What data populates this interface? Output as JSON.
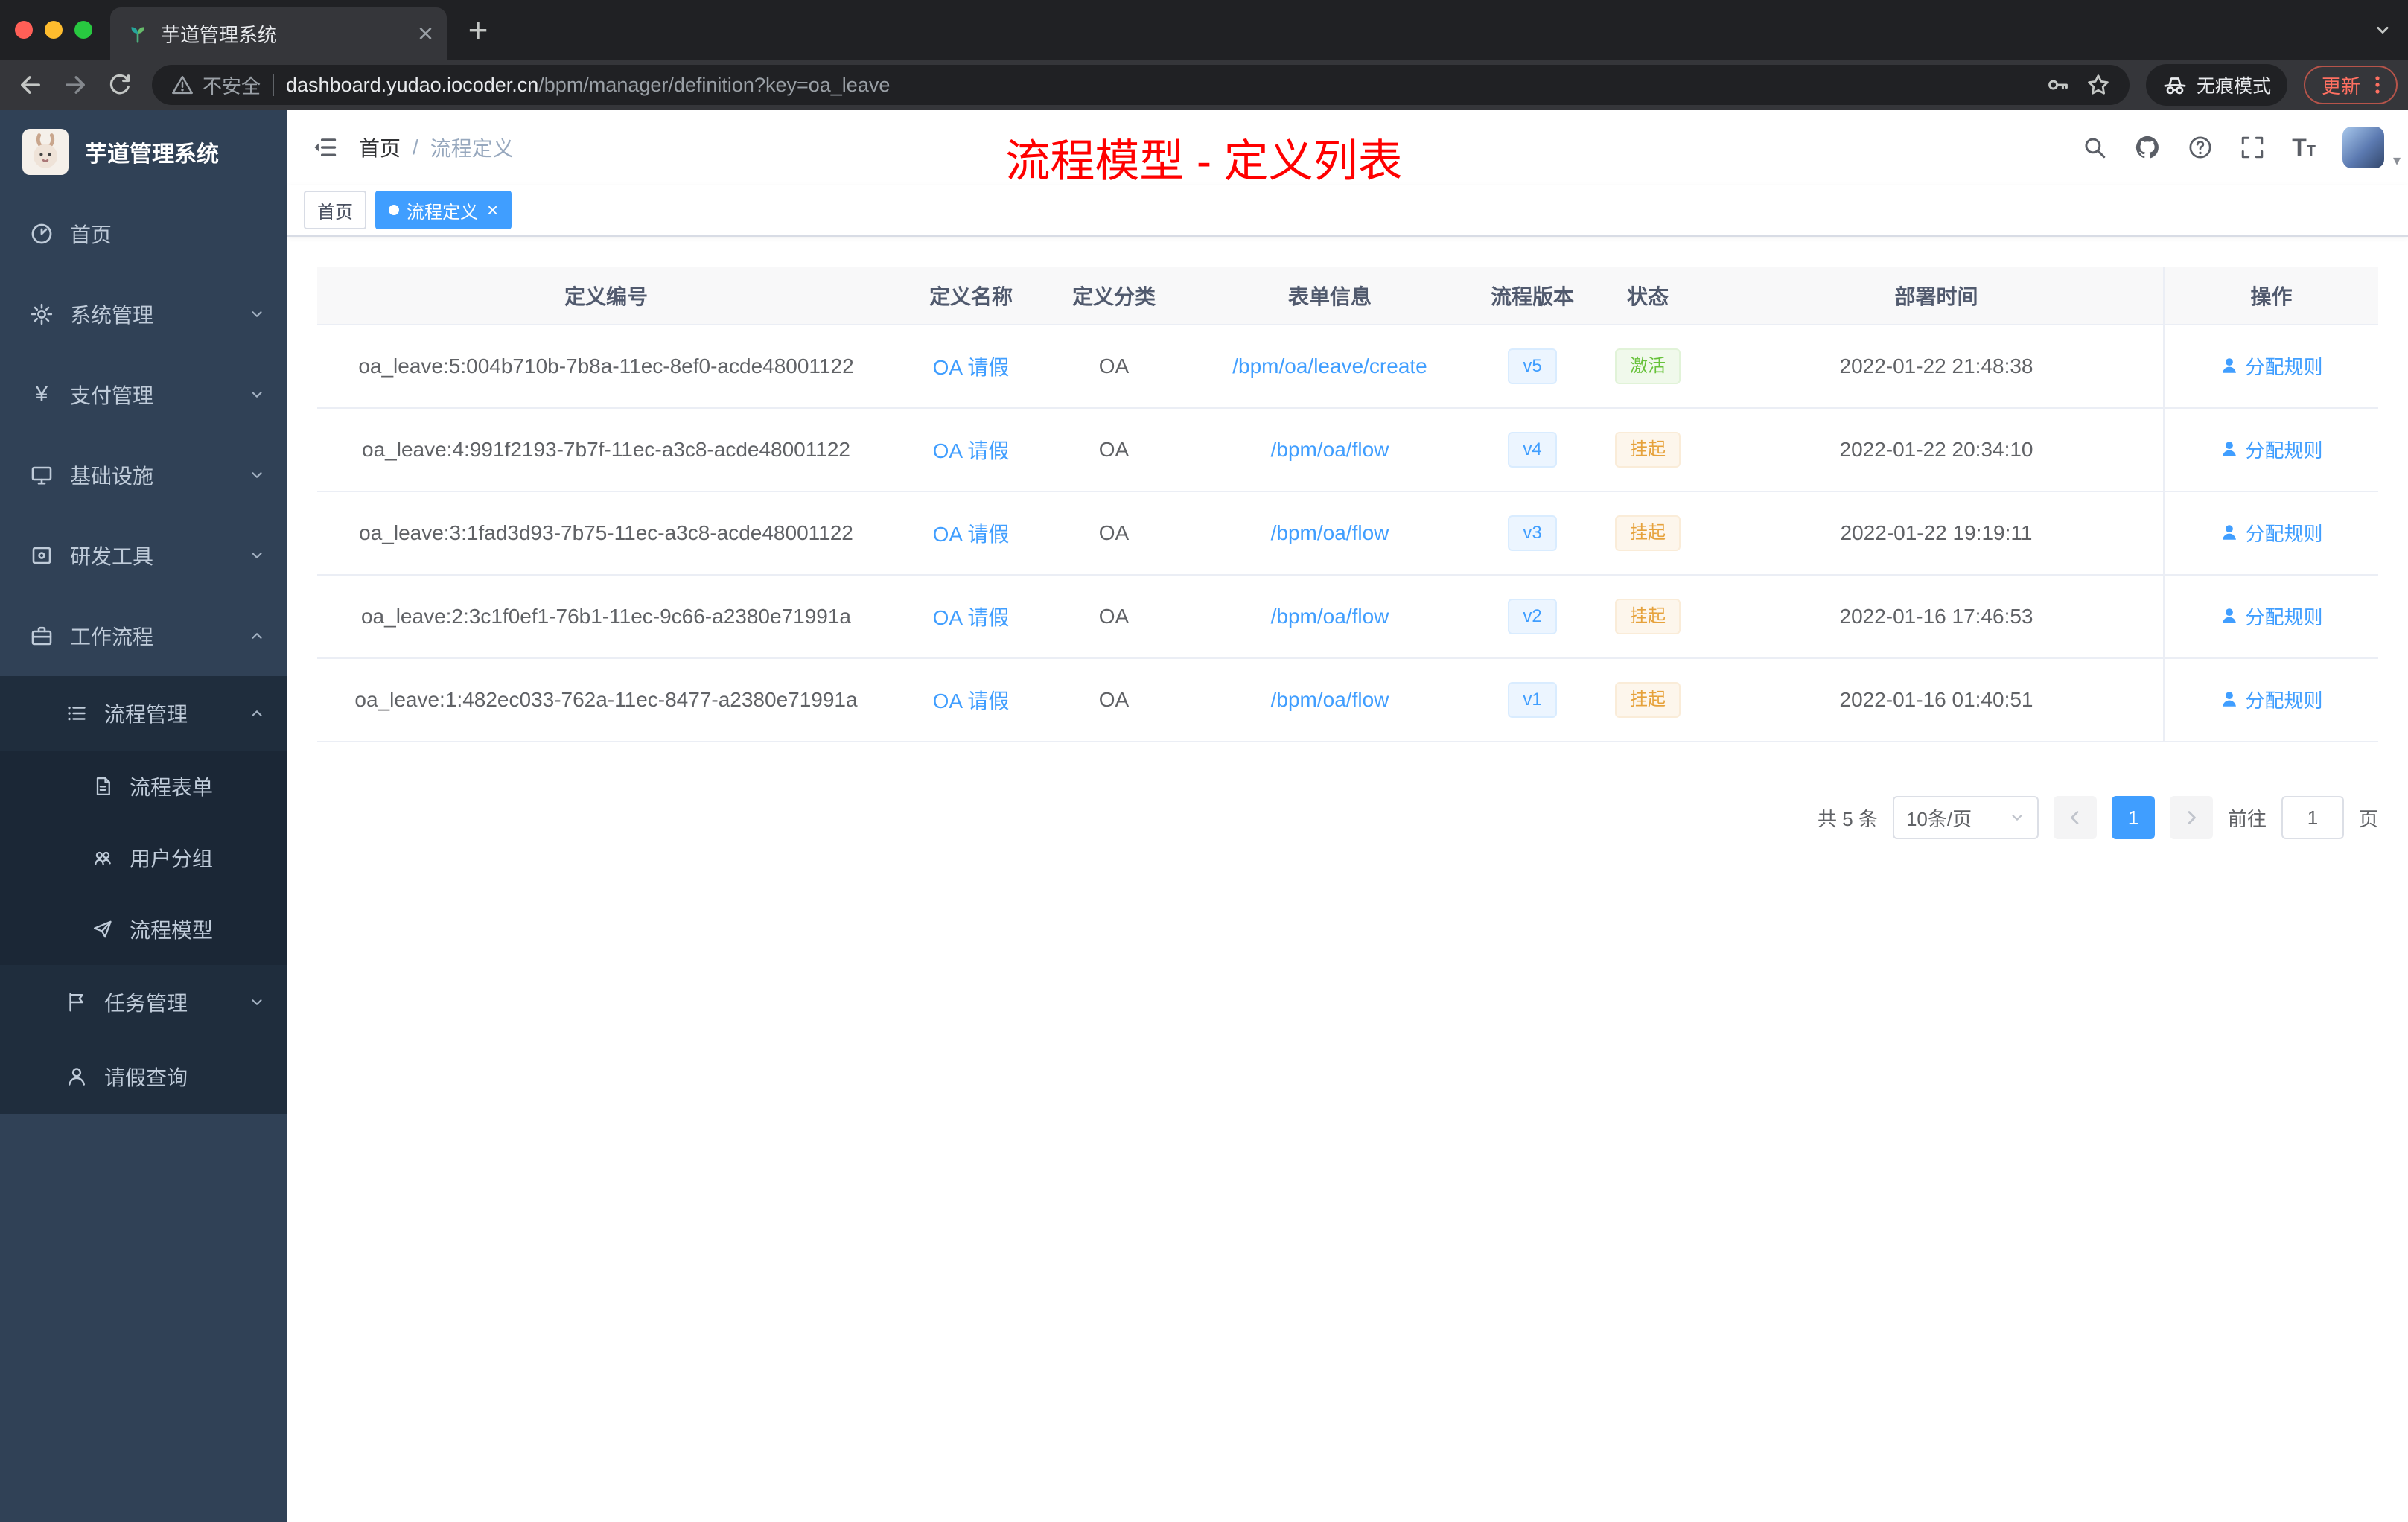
{
  "colors": {
    "accent": "#409EFF",
    "success": "#67C23A",
    "warning": "#E6A23C",
    "annotation_red": "#FF0000",
    "sidebar_bg": "#304156"
  },
  "browser": {
    "tab_title": "芋道管理系统",
    "security_label": "不安全",
    "url_domain": "dashboard.yudao.iocoder.cn",
    "url_path": "/bpm/manager/definition?key=oa_leave",
    "incognito_label": "无痕模式",
    "update_label": "更新"
  },
  "sidebar": {
    "logo_title": "芋道管理系统",
    "items": [
      {
        "label": "首页"
      },
      {
        "label": "系统管理"
      },
      {
        "label": "支付管理"
      },
      {
        "label": "基础设施"
      },
      {
        "label": "研发工具"
      },
      {
        "label": "工作流程"
      },
      {
        "label": "流程管理"
      },
      {
        "label": "流程表单"
      },
      {
        "label": "用户分组"
      },
      {
        "label": "流程模型"
      },
      {
        "label": "任务管理"
      },
      {
        "label": "请假查询"
      }
    ]
  },
  "header": {
    "breadcrumb_home": "首页",
    "breadcrumb_separator": "/",
    "breadcrumb_current": "流程定义",
    "annotation": "流程模型 - 定义列表"
  },
  "tags": {
    "home": "首页",
    "active": "流程定义"
  },
  "table": {
    "columns": {
      "id": "定义编号",
      "name": "定义名称",
      "category": "定义分类",
      "form": "表单信息",
      "version": "流程版本",
      "status": "状态",
      "deploy": "部署时间",
      "action": "操作"
    },
    "rows": [
      {
        "id": "oa_leave:5:004b710b-7b8a-11ec-8ef0-acde48001122",
        "name": "OA 请假",
        "category": "OA",
        "form": "/bpm/oa/leave/create",
        "version": "v5",
        "status": "激活",
        "deploy_time": "2022-01-22 21:48:38",
        "action": "分配规则"
      },
      {
        "id": "oa_leave:4:991f2193-7b7f-11ec-a3c8-acde48001122",
        "name": "OA 请假",
        "category": "OA",
        "form": "/bpm/oa/flow",
        "version": "v4",
        "status": "挂起",
        "deploy_time": "2022-01-22 20:34:10",
        "action": "分配规则"
      },
      {
        "id": "oa_leave:3:1fad3d93-7b75-11ec-a3c8-acde48001122",
        "name": "OA 请假",
        "category": "OA",
        "form": "/bpm/oa/flow",
        "version": "v3",
        "status": "挂起",
        "deploy_time": "2022-01-22 19:19:11",
        "action": "分配规则"
      },
      {
        "id": "oa_leave:2:3c1f0ef1-76b1-11ec-9c66-a2380e71991a",
        "name": "OA 请假",
        "category": "OA",
        "form": "/bpm/oa/flow",
        "version": "v2",
        "status": "挂起",
        "deploy_time": "2022-01-16 17:46:53",
        "action": "分配规则"
      },
      {
        "id": "oa_leave:1:482ec033-762a-11ec-8477-a2380e71991a",
        "name": "OA 请假",
        "category": "OA",
        "form": "/bpm/oa/flow",
        "version": "v1",
        "status": "挂起",
        "deploy_time": "2022-01-16 01:40:51",
        "action": "分配规则"
      }
    ]
  },
  "pagination": {
    "total": "共 5 条",
    "page_size": "10条/页",
    "page": "1",
    "goto_label": "前往",
    "goto_value": "1",
    "unit": "页"
  }
}
